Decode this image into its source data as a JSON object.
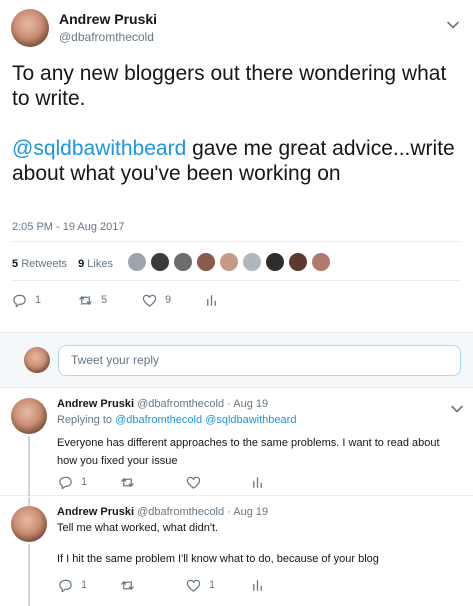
{
  "main_tweet": {
    "author_name": "Andrew Pruski",
    "author_handle": "@dbafromthecold",
    "text_line1": "To any new bloggers out there wondering what to write.",
    "mention": "@sqldbawithbeard",
    "text_line2": " gave me great advice...write about what you've been working on",
    "timestamp": "2:05 PM - 19 Aug 2017",
    "retweets_count": "5",
    "retweets_label": "Retweets",
    "likes_count": "9",
    "likes_label": "Likes",
    "actions": {
      "reply_count": "1",
      "retweet_count": "5",
      "like_count": "9"
    }
  },
  "reply_box": {
    "placeholder": "Tweet your reply"
  },
  "replies": [
    {
      "author_name": "Andrew Pruski",
      "author_handle": "@dbafromthecold",
      "separator": " · ",
      "date": "Aug 19",
      "replying_to_label": "Replying to ",
      "replying_to_1": "@dbafromthecold",
      "replying_to_2": "@sqldbawithbeard",
      "text": "Everyone has different approaches to the same problems. I want to read about how you fixed your issue",
      "actions": {
        "reply_count": "1",
        "retweet_count": "",
        "like_count": ""
      }
    },
    {
      "author_name": "Andrew Pruski",
      "author_handle": "@dbafromthecold",
      "separator": " · ",
      "date": "Aug 19",
      "text_line1": "Tell me what worked, what didn't.",
      "text_line2": "If I hit the same problem I'll know what to do, because of your blog",
      "actions": {
        "reply_count": "1",
        "retweet_count": "",
        "like_count": "1"
      }
    }
  ],
  "colors": {
    "link": "#1b95e0",
    "secondary": "#657786",
    "text": "#14171a",
    "border": "#e6ecf0"
  },
  "icons": [
    "caret-down-icon",
    "reply-icon",
    "retweet-icon",
    "heart-icon",
    "analytics-icon"
  ]
}
